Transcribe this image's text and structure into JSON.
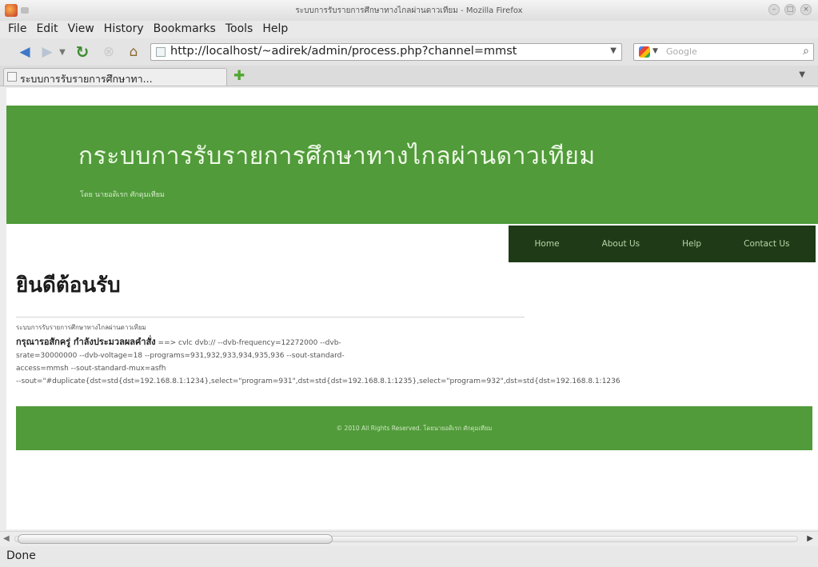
{
  "window": {
    "title": "ระบบการรับรายการศึกษาทางไกลผ่านดาวเทียม - Mozilla Firefox",
    "buttons": [
      "–",
      "□",
      "×"
    ]
  },
  "menu": [
    {
      "label": "File"
    },
    {
      "label": "Edit"
    },
    {
      "label": "View"
    },
    {
      "label": "History"
    },
    {
      "label": "Bookmarks"
    },
    {
      "label": "Tools"
    },
    {
      "label": "Help"
    }
  ],
  "toolbar": {
    "url": "http://localhost/~adirek/admin/process.php?channel=mmst",
    "search_placeholder": "Google"
  },
  "tabs": [
    {
      "label": "ระบบการรับรายการศึกษาทา..."
    }
  ],
  "page": {
    "header_title": "กระบบการรับรายการศึกษาทางไกลผ่านดาวเทียม",
    "header_subtitle": "โดย นายอดิเรก ศักดุมเทียม",
    "nav": [
      {
        "label": "Home"
      },
      {
        "label": "About Us"
      },
      {
        "label": "Help"
      },
      {
        "label": "Contact Us"
      }
    ],
    "welcome": "ยินดีต้อนรับ",
    "system_desc": "ระบบการรับรายการศึกษาทางไกลผ่านดาวเทียม",
    "status_label": "กรุณารอสักครู่ กำลังประมวลผลคำสั่ง",
    "command_line1": " ==> cvlc dvb:// --dvb-frequency=12272000 --dvb-",
    "command_line2": "srate=30000000 --dvb-voltage=18 --programs=931,932,933,934,935,936 --sout-standard-",
    "command_line3": "access=mmsh --sout-standard-mux=asfh",
    "command_line4": "--sout=\"#duplicate{dst=std{dst=192.168.8.1:1234},select=\"program=931\",dst=std{dst=192.168.8.1:1235},select=\"program=932\",dst=std{dst=192.168.8.1:1236",
    "footer": "© 2010 All Rights Reserved. โดยนายอดิเรก ศักดุมเทียม"
  },
  "status_bar": "Done"
}
